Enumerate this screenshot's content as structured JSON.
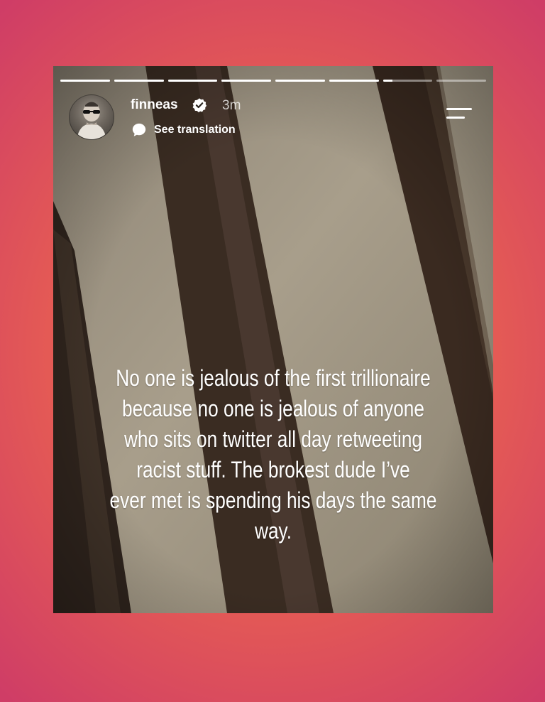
{
  "story": {
    "progress_segments": [
      1,
      1,
      1,
      1,
      1,
      1,
      0.2,
      0
    ],
    "user": {
      "username": "finneas",
      "verified": true,
      "time_ago": "3m"
    },
    "translate_label": "See translation",
    "caption_lines": [
      "No one is jealous of the first trillionaire",
      "because no one is jealous of anyone",
      "who sits on twitter all day retweeting",
      "racist stuff. The brokest dude I’ve",
      "ever met is spending his days the same",
      "way."
    ]
  },
  "colors": {
    "background_center": "#ef6f49",
    "background_edge": "#cf3d66",
    "verified_badge": "#ffffff"
  }
}
